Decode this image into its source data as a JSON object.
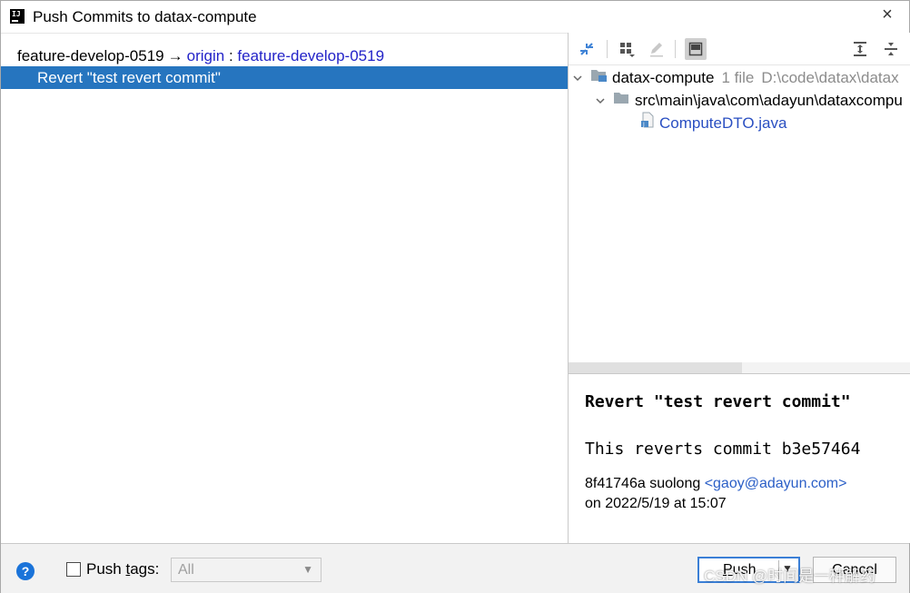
{
  "window": {
    "title": "Push Commits to datax-compute",
    "close_glyph": "×"
  },
  "branch": {
    "local": "feature-develop-0519",
    "arrow": "→",
    "remote": "origin",
    "separator": ":",
    "remote_branch": "feature-develop-0519"
  },
  "commits": [
    {
      "subject": "Revert \"test revert commit\""
    }
  ],
  "toolbar": {
    "icons": [
      "diff-arrows-icon",
      "group-by-icon",
      "edit-source-icon",
      "preview-diff-icon",
      "expand-all-icon",
      "collapse-all-icon"
    ]
  },
  "tree": {
    "root_name": "datax-compute",
    "root_count": "1 file",
    "root_path": "D:\\code\\datax\\datax",
    "folder_path": "src\\main\\java\\com\\adayun\\dataxcompu",
    "file_name": "ComputeDTO.java"
  },
  "details": {
    "subject": "Revert \"test revert commit\"",
    "body": "This reverts commit b3e57464",
    "hash": "8f41746a",
    "author": "suolong",
    "email": "<gaoy@adayun.com>",
    "date_line": "on 2022/5/19 at 15:07"
  },
  "footer": {
    "help": "?",
    "push_tags_label_pre": "Push ",
    "push_tags_label_u": "t",
    "push_tags_label_post": "ags:",
    "tags_select_value": "All",
    "push_label_pre": "",
    "push_label_u": "P",
    "push_label_post": "ush",
    "cancel_label": "Cancel"
  },
  "watermark": "CSDN @时间是一种解药",
  "colors": {
    "selection": "#2675bf",
    "link": "#2323c8",
    "primary_border": "#3b7fd6",
    "help": "#1a73d9"
  }
}
